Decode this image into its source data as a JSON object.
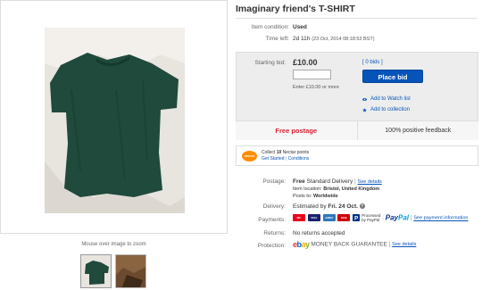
{
  "listing": {
    "title": "Imaginary friend's T-SHIRT",
    "condition_label": "Item condition:",
    "condition_value": "Used",
    "time_left_label": "Time left:",
    "time_left_value": "2d 11h",
    "time_left_detail": "(23 Oct, 2014  08:18:53 BST)"
  },
  "gallery": {
    "zoom_hint": "Mouse over image to zoom",
    "main_image_icon": "t-shirt-photo",
    "thumbs": [
      "thumbnail-1",
      "thumbnail-2"
    ]
  },
  "bid": {
    "starting_bid_label": "Starting bid:",
    "price": "£10.00",
    "input_value": "",
    "enter_hint": "Enter £10.00 or more",
    "bids_link": "[ 0 bids ]",
    "place_bid_label": "Place bid",
    "watch_label": "Add to Watch list",
    "collection_label": "Add to collection"
  },
  "banner": {
    "free_postage": "Free postage",
    "feedback": "100% positive feedback"
  },
  "nectar": {
    "logo_text": "nectar",
    "collect_prefix": "Collect",
    "points": "10",
    "collect_suffix": "Nectar points",
    "get_started": "Get Started",
    "separator": "|",
    "conditions": "Conditions"
  },
  "details": {
    "postage_label": "Postage:",
    "postage_free": "Free",
    "postage_service": "Standard Delivery",
    "postage_sep": "|",
    "see_details": "See details",
    "item_location_label": "Item location:",
    "item_location": "Bristol, United Kingdom",
    "posts_to_label": "Posts to:",
    "posts_to": "Worldwide",
    "delivery_label": "Delivery:",
    "delivery_prefix": "Estimated by",
    "delivery_date": "Fri. 24 Oct.",
    "payments_label": "Payments:",
    "payment_cards": [
      "MC",
      "VISA",
      "AMEX",
      "MAE"
    ],
    "processed_line1": "Processed",
    "processed_line2": "by PayPal",
    "paypal_p1": "Pay",
    "paypal_p2": "Pal",
    "payment_sep": "|",
    "see_payment": "See payment information",
    "returns_label": "Returns:",
    "returns_value": "No returns accepted",
    "protection_label": "Protection:",
    "ebay_e": "e",
    "ebay_b": "b",
    "ebay_a": "a",
    "ebay_y": "y",
    "guarantee": "MONEY BACK GUARANTEE",
    "guarantee_sep": "|",
    "guarantee_details": "See details"
  },
  "colors": {
    "link": "#0654ba",
    "place_bid_bg": "#0654ba",
    "free_postage": "#dd1e31",
    "nectar": "#ff8c00"
  }
}
